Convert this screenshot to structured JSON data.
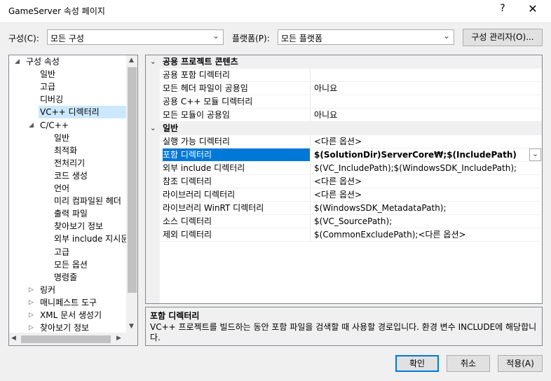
{
  "window": {
    "title": "GameServer 속성 페이지",
    "help": "?",
    "close": "✕"
  },
  "config": {
    "label": "구성(C):",
    "value": "모든 구성"
  },
  "platform": {
    "label": "플랫폼(P):",
    "value": "모든 플랫폼"
  },
  "config_manager_button": "구성 관리자(O)...",
  "tree": [
    {
      "label": "구성 속성",
      "level": 0,
      "expander": "open"
    },
    {
      "label": "일반",
      "level": 1
    },
    {
      "label": "고급",
      "level": 1
    },
    {
      "label": "디버깅",
      "level": 1
    },
    {
      "label": "VC++ 디렉터리",
      "level": 1,
      "selected": true
    },
    {
      "label": "C/C++",
      "level": 1,
      "expander": "open"
    },
    {
      "label": "일반",
      "level": 2
    },
    {
      "label": "최적화",
      "level": 2
    },
    {
      "label": "전처리기",
      "level": 2
    },
    {
      "label": "코드 생성",
      "level": 2
    },
    {
      "label": "언어",
      "level": 2
    },
    {
      "label": "미리 컴파일된 헤더",
      "level": 2
    },
    {
      "label": "출력 파일",
      "level": 2
    },
    {
      "label": "찾아보기 정보",
      "level": 2
    },
    {
      "label": "외부 include 지시문",
      "level": 2
    },
    {
      "label": "고급",
      "level": 2
    },
    {
      "label": "모든 옵션",
      "level": 2
    },
    {
      "label": "명령줄",
      "level": 2
    },
    {
      "label": "링커",
      "level": 1,
      "expander": "closed"
    },
    {
      "label": "매니페스트 도구",
      "level": 1,
      "expander": "closed"
    },
    {
      "label": "XML 문서 생성기",
      "level": 1,
      "expander": "closed"
    },
    {
      "label": "찾아보기 정보",
      "level": 1,
      "expander": "closed"
    }
  ],
  "grid": [
    {
      "type": "category",
      "label": "공용 프로젝트 콘텐츠"
    },
    {
      "name": "공용 포함 디렉터리",
      "value": ""
    },
    {
      "name": "모든 헤더 파일이 공용임",
      "value": "아니요"
    },
    {
      "name": "공용 C++ 모듈 디렉터리",
      "value": ""
    },
    {
      "name": "모든 모듈이 공용임",
      "value": "아니요"
    },
    {
      "type": "category",
      "label": "일반"
    },
    {
      "name": "실행 가능 디렉터리",
      "value": "<다른 옵션>"
    },
    {
      "name": "포함 디렉터리",
      "value": "$(SolutionDir)ServerCore₩;$(IncludePath)",
      "selected": true
    },
    {
      "name": "외부 include 디렉터리",
      "value": "$(VC_IncludePath);$(WindowsSDK_IncludePath);"
    },
    {
      "name": "참조 디렉터리",
      "value": "<다른 옵션>"
    },
    {
      "name": "라이브러리 디렉터리",
      "value": "<다른 옵션>"
    },
    {
      "name": "라이브러리 WinRT 디렉터리",
      "value": "$(WindowsSDK_MetadataPath);"
    },
    {
      "name": "소스 디렉터리",
      "value": "$(VC_SourcePath);"
    },
    {
      "name": "제외 디렉터리",
      "value": "$(CommonExcludePath);<다른 옵션>"
    }
  ],
  "description": {
    "title": "포함 디렉터리",
    "text": "VC++ 프로젝트를 빌드하는 동안 포함 파일을 검색할 때 사용할 경로입니다.  환경 변수 INCLUDE에 해당합니다."
  },
  "buttons": {
    "ok": "확인",
    "cancel": "취소",
    "apply": "적용(A)"
  },
  "colors": {
    "selection": "#0078d7",
    "tree_selection": "#cce8ff"
  }
}
